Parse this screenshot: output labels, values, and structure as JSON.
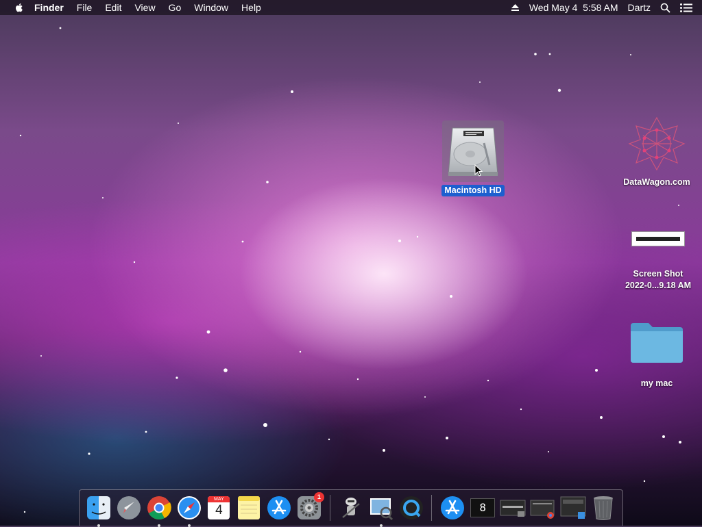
{
  "menubar": {
    "app_name": "Finder",
    "menus": [
      "File",
      "Edit",
      "View",
      "Go",
      "Window",
      "Help"
    ],
    "clock": "Wed May 4  5:58 AM",
    "user": "Dartz"
  },
  "desktop": {
    "drive_label": "Macintosh HD",
    "datawagon_label": "DataWagon.com",
    "screenshot_label_line1": "Screen Shot",
    "screenshot_label_line2": "2022-0...9.18 AM",
    "folder_label": "my mac"
  },
  "dock": {
    "calendar_month": "MAY",
    "calendar_day": "4",
    "prefs_badge": "1",
    "terminal_text": "8"
  },
  "colors": {
    "selection": "#1d5fcf",
    "folder": "#5aa9d6"
  }
}
